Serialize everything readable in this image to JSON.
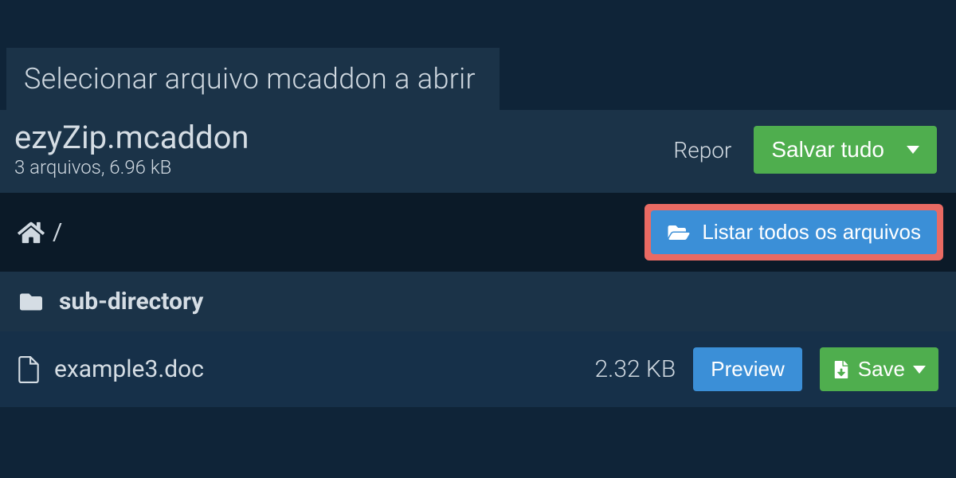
{
  "tab": {
    "title": "Selecionar arquivo mcaddon a abrir"
  },
  "file": {
    "name": "ezyZip.mcaddon",
    "meta": "3 arquivos, 6.96 kB"
  },
  "actions": {
    "reset_label": "Repor",
    "save_all_label": "Salvar tudo"
  },
  "breadcrumb": {
    "path_separator": "/",
    "list_all_label": "Listar todos os arquivos"
  },
  "rows": [
    {
      "type": "folder",
      "name": "sub-directory"
    },
    {
      "type": "file",
      "name": "example3.doc",
      "size": "2.32 KB"
    }
  ],
  "row_actions": {
    "preview_label": "Preview",
    "save_label": "Save"
  }
}
